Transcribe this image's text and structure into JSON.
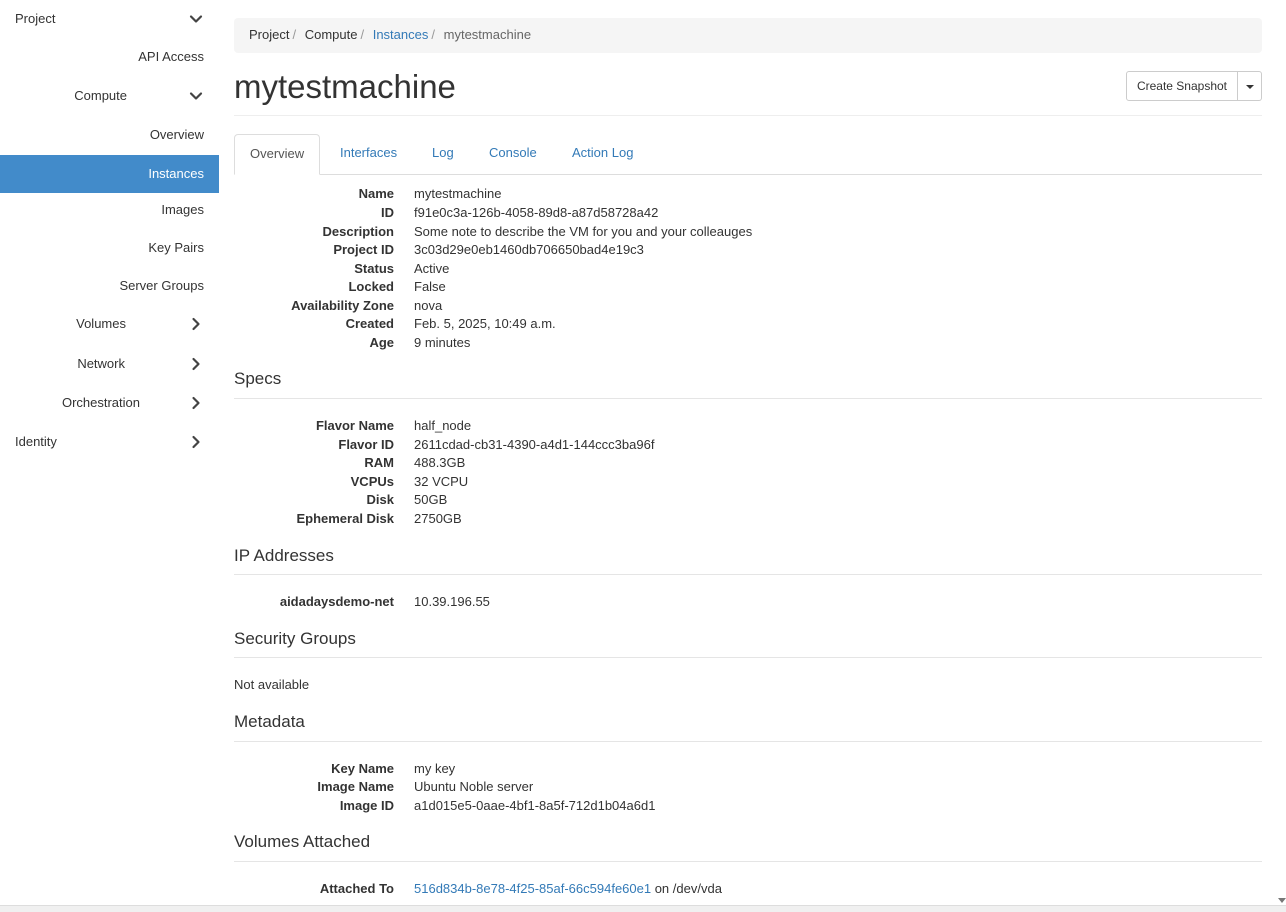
{
  "sidebar": {
    "project": "Project",
    "api_access": "API Access",
    "compute": "Compute",
    "overview": "Overview",
    "instances": "Instances",
    "images": "Images",
    "key_pairs": "Key Pairs",
    "server_groups": "Server Groups",
    "volumes": "Volumes",
    "network": "Network",
    "orchestration": "Orchestration",
    "identity": "Identity"
  },
  "breadcrumb": {
    "project": "Project",
    "compute": "Compute",
    "instances": "Instances",
    "current": "mytestmachine",
    "separator": "/"
  },
  "page_title": "mytestmachine",
  "actions": {
    "create_snapshot": "Create Snapshot"
  },
  "tabs": [
    "Overview",
    "Interfaces",
    "Log",
    "Console",
    "Action Log"
  ],
  "overview": {
    "name_label": "Name",
    "name": "mytestmachine",
    "id_label": "ID",
    "id": "f91e0c3a-126b-4058-89d8-a87d58728a42",
    "description_label": "Description",
    "description": "Some note to describe the VM for you and your colleauges",
    "project_id_label": "Project ID",
    "project_id": "3c03d29e0eb1460db706650bad4e19c3",
    "status_label": "Status",
    "status": "Active",
    "locked_label": "Locked",
    "locked": "False",
    "az_label": "Availability Zone",
    "az": "nova",
    "created_label": "Created",
    "created": "Feb. 5, 2025, 10:49 a.m.",
    "age_label": "Age",
    "age": "9 minutes"
  },
  "specs": {
    "heading": "Specs",
    "flavor_name_label": "Flavor Name",
    "flavor_name": "half_node",
    "flavor_id_label": "Flavor ID",
    "flavor_id": "2611cdad-cb31-4390-a4d1-144ccc3ba96f",
    "ram_label": "RAM",
    "ram": "488.3GB",
    "vcpus_label": "VCPUs",
    "vcpus": "32 VCPU",
    "disk_label": "Disk",
    "disk": "50GB",
    "ephemeral_label": "Ephemeral Disk",
    "ephemeral": "2750GB"
  },
  "ip_addresses": {
    "heading": "IP Addresses",
    "network_label": "aidadaysdemo-net",
    "address": "10.39.196.55"
  },
  "security_groups": {
    "heading": "Security Groups",
    "value": "Not available"
  },
  "metadata": {
    "heading": "Metadata",
    "key_name_label": "Key Name",
    "key_name": "my key",
    "image_name_label": "Image Name",
    "image_name": "Ubuntu Noble server",
    "image_id_label": "Image ID",
    "image_id": "a1d015e5-0aae-4bf1-8a5f-712d1b04a6d1"
  },
  "volumes_attached": {
    "heading": "Volumes Attached",
    "attached_to_label": "Attached To",
    "volume_id": "516d834b-8e78-4f25-85af-66c594fe60e1",
    "device_text": " on /dev/vda"
  }
}
